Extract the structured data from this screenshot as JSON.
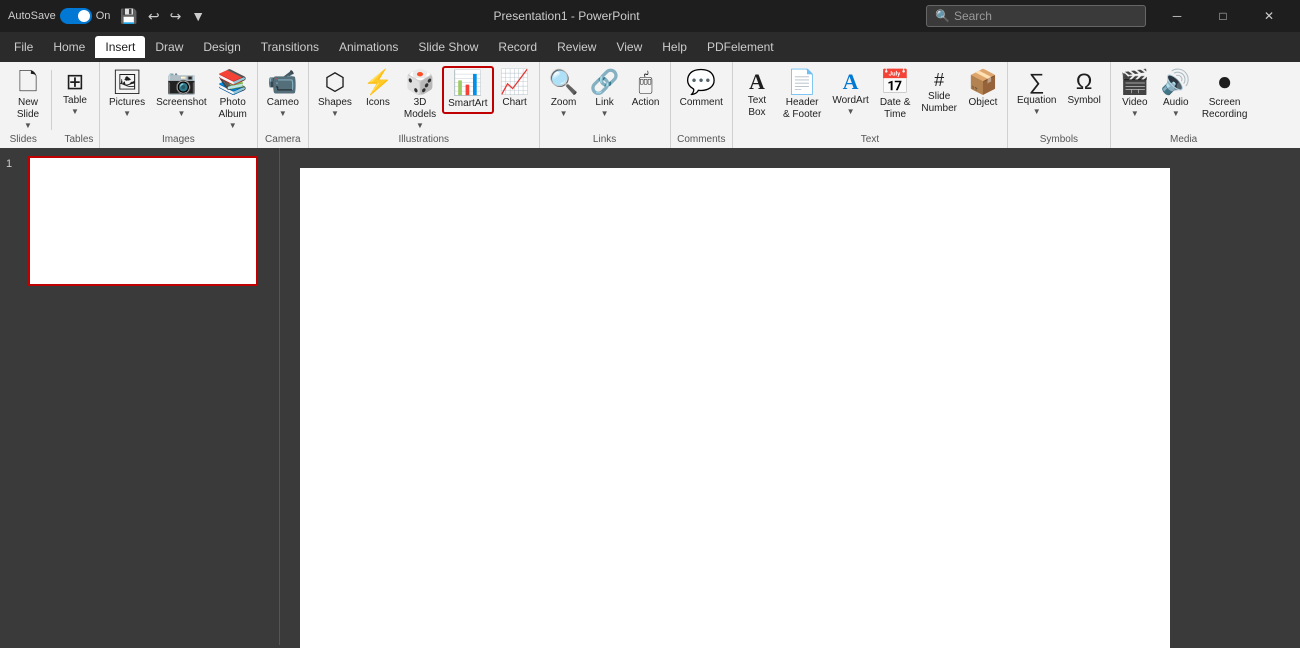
{
  "titlebar": {
    "autosave": "AutoSave",
    "toggle_state": "On",
    "app_title": "Presentation1 - PowerPoint",
    "search_placeholder": "Search",
    "save_icon": "💾",
    "undo_icon": "↩",
    "redo_icon": "↪",
    "customize_icon": "▼"
  },
  "menubar": {
    "items": [
      "File",
      "Home",
      "Insert",
      "Draw",
      "Design",
      "Transitions",
      "Animations",
      "Slide Show",
      "Record",
      "Review",
      "View",
      "Help",
      "PDFelement"
    ],
    "active": "Insert"
  },
  "ribbon": {
    "groups": [
      {
        "id": "slides",
        "label": "Slides",
        "items": [
          {
            "id": "new-slide",
            "icon": "🗋",
            "label": "New\nSlide",
            "dropdown": true
          }
        ],
        "small_items": [
          {
            "id": "table",
            "icon": "⊞",
            "label": "Table",
            "dropdown": true
          }
        ]
      },
      {
        "id": "images",
        "label": "Images",
        "items": [
          {
            "id": "pictures",
            "icon": "🖼",
            "label": "Pictures",
            "dropdown": true
          },
          {
            "id": "screenshot",
            "icon": "📷",
            "label": "Screenshot",
            "dropdown": true
          },
          {
            "id": "photo-album",
            "icon": "📚",
            "label": "Photo\nAlbum",
            "dropdown": true
          }
        ]
      },
      {
        "id": "camera",
        "label": "Camera",
        "items": [
          {
            "id": "cameo",
            "icon": "📹",
            "label": "Cameo",
            "dropdown": true
          }
        ]
      },
      {
        "id": "illustrations",
        "label": "Illustrations",
        "items": [
          {
            "id": "shapes",
            "icon": "⬡",
            "label": "Shapes",
            "dropdown": true
          },
          {
            "id": "icons",
            "icon": "⚡",
            "label": "Icons"
          },
          {
            "id": "3d-models",
            "icon": "🎲",
            "label": "3D\nModels",
            "dropdown": true
          },
          {
            "id": "smartart",
            "icon": "📊",
            "label": "SmartArt",
            "highlight": true
          },
          {
            "id": "chart",
            "icon": "📈",
            "label": "Chart"
          }
        ]
      },
      {
        "id": "links",
        "label": "Links",
        "items": [
          {
            "id": "zoom",
            "icon": "🔍",
            "label": "Zoom",
            "dropdown": true
          },
          {
            "id": "link",
            "icon": "🔗",
            "label": "Link",
            "dropdown": true
          },
          {
            "id": "action",
            "icon": "🖱",
            "label": "Action"
          }
        ]
      },
      {
        "id": "comments",
        "label": "Comments",
        "items": [
          {
            "id": "comment",
            "icon": "💬",
            "label": "Comment"
          }
        ]
      },
      {
        "id": "text",
        "label": "Text",
        "items": [
          {
            "id": "text-box",
            "icon": "A",
            "label": "Text\nBox"
          },
          {
            "id": "header-footer",
            "icon": "📄",
            "label": "Header\n& Footer"
          },
          {
            "id": "wordart",
            "icon": "A",
            "label": "WordArt",
            "dropdown": true
          },
          {
            "id": "date-time",
            "icon": "📅",
            "label": "Date &\nTime"
          },
          {
            "id": "slide-number",
            "icon": "#",
            "label": "Slide\nNumber"
          },
          {
            "id": "object",
            "icon": "📦",
            "label": "Object"
          }
        ]
      },
      {
        "id": "symbols",
        "label": "Symbols",
        "items": [
          {
            "id": "equation",
            "icon": "∑",
            "label": "Equation",
            "dropdown": true
          },
          {
            "id": "symbol",
            "icon": "Ω",
            "label": "Symbol"
          }
        ]
      },
      {
        "id": "media",
        "label": "Media",
        "items": [
          {
            "id": "video",
            "icon": "🎬",
            "label": "Video",
            "dropdown": true
          },
          {
            "id": "audio",
            "icon": "🔊",
            "label": "Audio",
            "dropdown": true
          },
          {
            "id": "screen-recording",
            "icon": "⏺",
            "label": "Screen\nRecording"
          }
        ]
      }
    ]
  },
  "slide": {
    "number": 1
  }
}
